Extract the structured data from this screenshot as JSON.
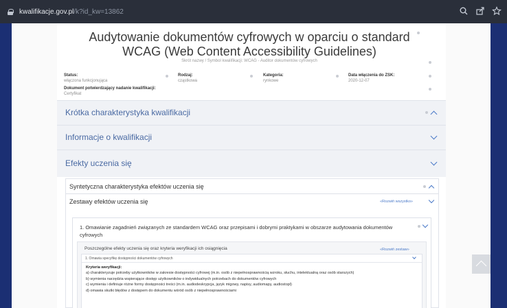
{
  "browser": {
    "url_domain": "kwalifikacje.gov.pl",
    "url_path": "/k?id_kw=13862",
    "icons": [
      "lock-icon",
      "zoom-icon",
      "share-icon",
      "star-icon"
    ]
  },
  "header": {
    "title": "Audytowanie dokumentów cyfrowych w oparciu o standard WCAG (Web Content Accessibility Guidelines)",
    "subtitle": "Skrót nazwy / Symbol kwalifikacji: WCAG - Auditor dokumentów cyfrowych"
  },
  "meta": {
    "status_label": "Status:",
    "status_value": "włączona funkcjonująca",
    "rodzaj_label": "Rodzaj:",
    "rodzaj_value": "cząstkowa",
    "kategoria_label": "Kategoria:",
    "kategoria_value": "rynkowe",
    "data_label": "Data włączenia do ZSK:",
    "data_value": "2020-12-07",
    "dokument_label": "Dokument potwierdzający nadanie kwalifikacji:",
    "dokument_value": "Certyfikat"
  },
  "sections": {
    "krotka": "Krótka charakterystyka kwalifikacji",
    "informacje": "Informacje o kwalifikacji",
    "efekty": "Efekty uczenia się"
  },
  "efekty": {
    "syntetyczna": "Syntetyczna charakterystyka efektów uczenia się",
    "zestawy": "Zestawy efektów uczenia się",
    "rozwin_wszystko": "«Rozwiń wszystko»",
    "zestaw1_title": "1. Omawianie zagadnień związanych ze standardem WCAG oraz przepisami i dobrymi praktykami w obszarze audytowania dokumentów cyfrowych",
    "poszczegolne": "Poszczególne efekty uczenia się oraz kryteria weryfikacji ich osiągnięcia",
    "rozwin_zestaw": "«Rozwiń zestaw»",
    "efekt1": "1. Omawia specyfikę dostępności dokumentów cyfrowych",
    "kryteria_title": "Kryteria weryfikacji:",
    "kryteria": [
      "a) charakteryzuje potrzeby użytkowników w zakresie dostępności cyfrowej (m.in. osób z niepełnosprawnością wzroku, słuchu, intelektualną oraz osób starszych)",
      "b) wymienia narzędzia wspierające dostęp użytkowników o indywidualnych potrzebach do dokumentów cyfrowych",
      "c) wymienia i definiuje różne formy dostępności treści (m.in. audiodeskrypcja, język migowy, napisy, audiomapy, audiostopl)",
      "d) omawia skutki błędów z dostępem do dokumentu wśród osób z niepełnosprawnościami"
    ]
  }
}
